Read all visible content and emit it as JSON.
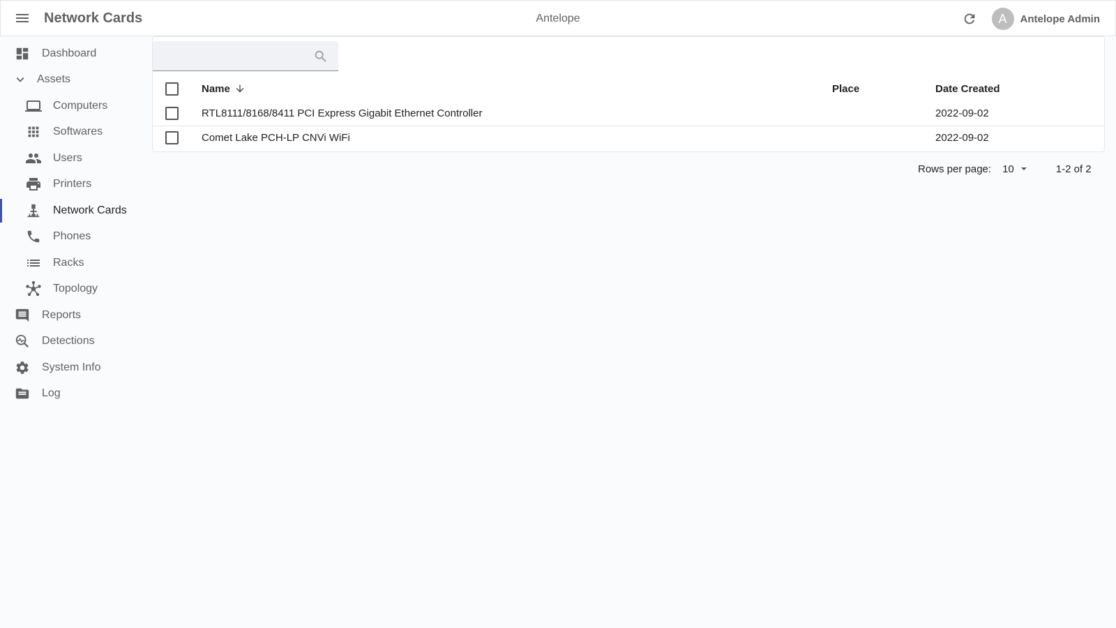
{
  "appbar": {
    "title": "Network Cards",
    "center": "Antelope",
    "avatar_letter": "A",
    "user_name": "Antelope Admin"
  },
  "sidebar": {
    "items": [
      {
        "label": "Dashboard",
        "icon": "dashboard-icon"
      },
      {
        "label": "Assets",
        "icon": "chevron-down-icon"
      },
      {
        "label": "Computers",
        "icon": "laptop-icon"
      },
      {
        "label": "Softwares",
        "icon": "apps-grid-icon"
      },
      {
        "label": "Users",
        "icon": "people-icon"
      },
      {
        "label": "Printers",
        "icon": "printer-icon"
      },
      {
        "label": "Network Cards",
        "icon": "network-icon"
      },
      {
        "label": "Phones",
        "icon": "phone-icon"
      },
      {
        "label": "Racks",
        "icon": "list-icon"
      },
      {
        "label": "Topology",
        "icon": "hub-icon"
      },
      {
        "label": "Reports",
        "icon": "comment-icon"
      },
      {
        "label": "Detections",
        "icon": "search-activity-icon"
      },
      {
        "label": "System Info",
        "icon": "gear-icon"
      },
      {
        "label": "Log",
        "icon": "folder-icon"
      }
    ],
    "active": "Network Cards"
  },
  "search": {
    "placeholder": "",
    "value": ""
  },
  "table": {
    "headers": {
      "name": "Name",
      "place": "Place",
      "date": "Date Created"
    },
    "rows": [
      {
        "name": "RTL8111/8168/8411 PCI Express Gigabit Ethernet Controller",
        "place": "",
        "date": "2022-09-02"
      },
      {
        "name": "Comet Lake PCH-LP CNVi WiFi",
        "place": "",
        "date": "2022-09-02"
      }
    ]
  },
  "pagination": {
    "rows_per_page_label": "Rows per page:",
    "rows_per_page": "10",
    "range": "1-2 of 2"
  },
  "colors": {
    "accent": "#3f51b5",
    "icon": "#616161"
  }
}
